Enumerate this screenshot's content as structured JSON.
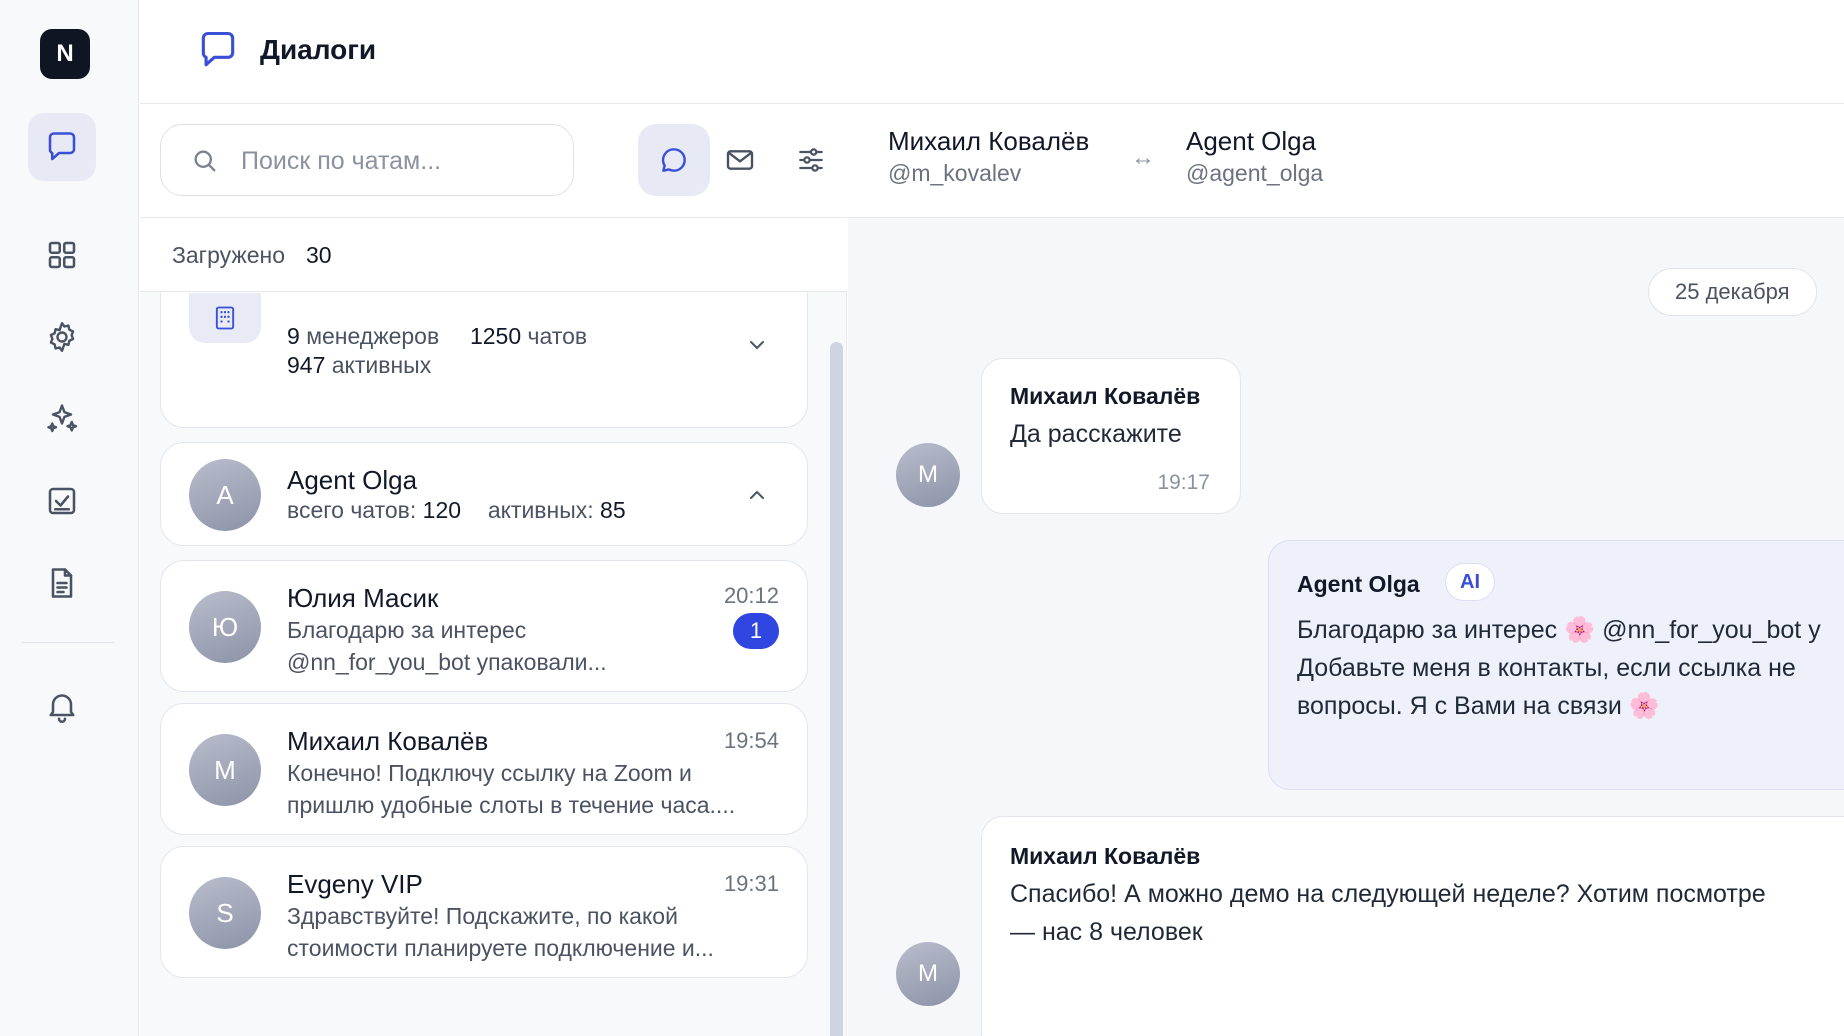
{
  "app": {
    "logo": "N",
    "title": "Диалоги",
    "title_icon": "chat-bubble-icon"
  },
  "sidebar": {
    "items": [
      {
        "name": "chats",
        "icon": "chat-bubble-icon",
        "active": true
      },
      {
        "name": "dashboard",
        "icon": "grid-icon",
        "active": false
      },
      {
        "name": "settings",
        "icon": "gear-icon",
        "active": false
      },
      {
        "name": "ai",
        "icon": "sparkles-icon",
        "active": false
      },
      {
        "name": "tasks",
        "icon": "checkbox-icon",
        "active": false
      },
      {
        "name": "documents",
        "icon": "document-icon",
        "active": false
      },
      {
        "name": "notifications",
        "icon": "bell-icon",
        "active": false
      }
    ]
  },
  "list": {
    "search_placeholder": "Поиск по чатам...",
    "search_value": "",
    "tools": [
      {
        "name": "chats-filter",
        "icon": "chat-bubble-icon",
        "active": true
      },
      {
        "name": "mail-filter",
        "icon": "mail-icon",
        "active": false
      },
      {
        "name": "settings-filter",
        "icon": "sliders-icon",
        "active": false
      }
    ],
    "loaded_label": "Загружено",
    "loaded_count": "30",
    "org_group": {
      "managers_count": "9",
      "managers_label": "менеджеров",
      "chats_count": "1250",
      "chats_label": "чатов",
      "active_count": "947",
      "active_label": "активных"
    },
    "agent_group": {
      "initial": "A",
      "name": "Agent Olga",
      "total_label": "всего чатов:",
      "total_value": "120",
      "active_label": "активных:",
      "active_value": "85"
    },
    "chats": [
      {
        "initial": "Ю",
        "name": "Юлия Масик",
        "time": "20:12",
        "preview_line1": "Благодарю за интерес",
        "preview_line2": "@nn_for_you_bot упаковали...",
        "unread": "1"
      },
      {
        "initial": "М",
        "name": "Михаил Ковалёв",
        "time": "19:54",
        "preview_line1": "Конечно! Подключу ссылку на Zoom и",
        "preview_line2": "пришлю удобные слоты в течение часа...."
      },
      {
        "initial": "S",
        "name": "Evgeny VIP",
        "time": "19:31",
        "preview_line1": "Здравствуйте! Подскажите, по какой",
        "preview_line2": "стоимости планируете подключение и..."
      }
    ]
  },
  "conversation": {
    "left_name": "Михаил Ковалёв",
    "left_handle": "@m_kovalev",
    "arrow": "↔",
    "right_name": "Agent Olga",
    "right_handle": "@agent_olga",
    "date": "25 декабря",
    "messages": [
      {
        "initial": "М",
        "author": "Михаил Ковалёв",
        "text": "Да расскажите",
        "time": "19:17"
      },
      {
        "author": "Agent Olga",
        "tag": "AI",
        "line1": "Благодарю за интерес 🌸 @nn_for_you_bot y",
        "line2": "Добавьте меня в контакты, если ссылка не",
        "line3": "вопросы. Я с Вами на связи 🌸"
      },
      {
        "initial": "М",
        "author": "Михаил Ковалёв",
        "line1": "Спасибо! А можно демо на следующей неделе? Хотим посмотре",
        "line2": "— нас 8 человек"
      }
    ]
  }
}
